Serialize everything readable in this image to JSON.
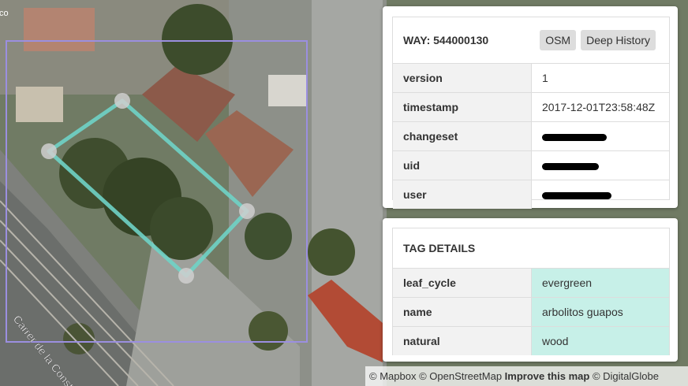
{
  "colors": {
    "outline": "#6fd3c6",
    "bbox": "#9b8fe0",
    "tag_value_bg": "#c7f0e8"
  },
  "map": {
    "street_label": "Carrer de la Consti",
    "corner_text": "co"
  },
  "way_panel": {
    "title": "WAY: 544000130",
    "osm_button": "OSM",
    "history_button": "Deep History",
    "rows": [
      {
        "key": "version",
        "value": "1",
        "redacted": false
      },
      {
        "key": "timestamp",
        "value": "2017-12-01T23:58:48Z",
        "redacted": false
      },
      {
        "key": "changeset",
        "value": "",
        "redacted": true
      },
      {
        "key": "uid",
        "value": "",
        "redacted": true
      },
      {
        "key": "user",
        "value": "",
        "redacted": true
      }
    ]
  },
  "tag_panel": {
    "title": "TAG DETAILS",
    "rows": [
      {
        "key": "leaf_cycle",
        "value": "evergreen"
      },
      {
        "key": "name",
        "value": "arbolitos guapos"
      },
      {
        "key": "natural",
        "value": "wood"
      }
    ]
  },
  "attribution": {
    "mapbox": "© Mapbox",
    "osm": "© OpenStreetMap",
    "improve": "Improve this map",
    "imagery": "© DigitalGlobe"
  }
}
